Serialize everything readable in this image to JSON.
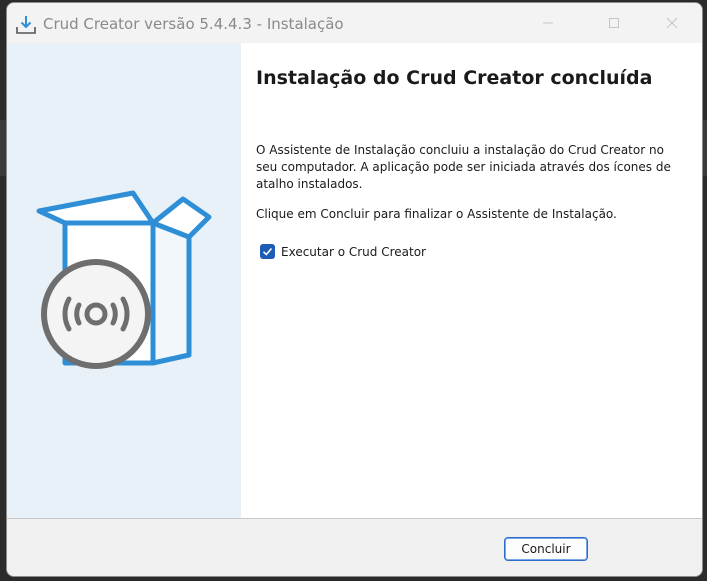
{
  "window": {
    "title": "Crud Creator versão 5.4.4.3 - Instalação",
    "icon": "install-download-icon",
    "controls": [
      "minimize-icon",
      "maximize-icon",
      "close-icon"
    ]
  },
  "side_panel": {
    "illustration": "software-box-with-disc-icon",
    "colors": {
      "background": "#e8f1f8",
      "box_outline": "#2f8fd6",
      "disc": "#6e6e6e"
    }
  },
  "main": {
    "heading": "Instalação do Crud Creator concluída",
    "paragraph1": "O Assistente de Instalação concluiu a instalação do Crud Creator no seu computador. A aplicação pode ser iniciada através dos ícones de atalho instalados.",
    "paragraph2": "Clique em Concluir para finalizar o Assistente de Instalação.",
    "checkbox": {
      "label": "Executar o Crud Creator",
      "checked": true
    }
  },
  "footer": {
    "finish_button": "Concluir"
  },
  "colors": {
    "accent": "#1e5bb5",
    "button_border": "#2d6cc9"
  }
}
